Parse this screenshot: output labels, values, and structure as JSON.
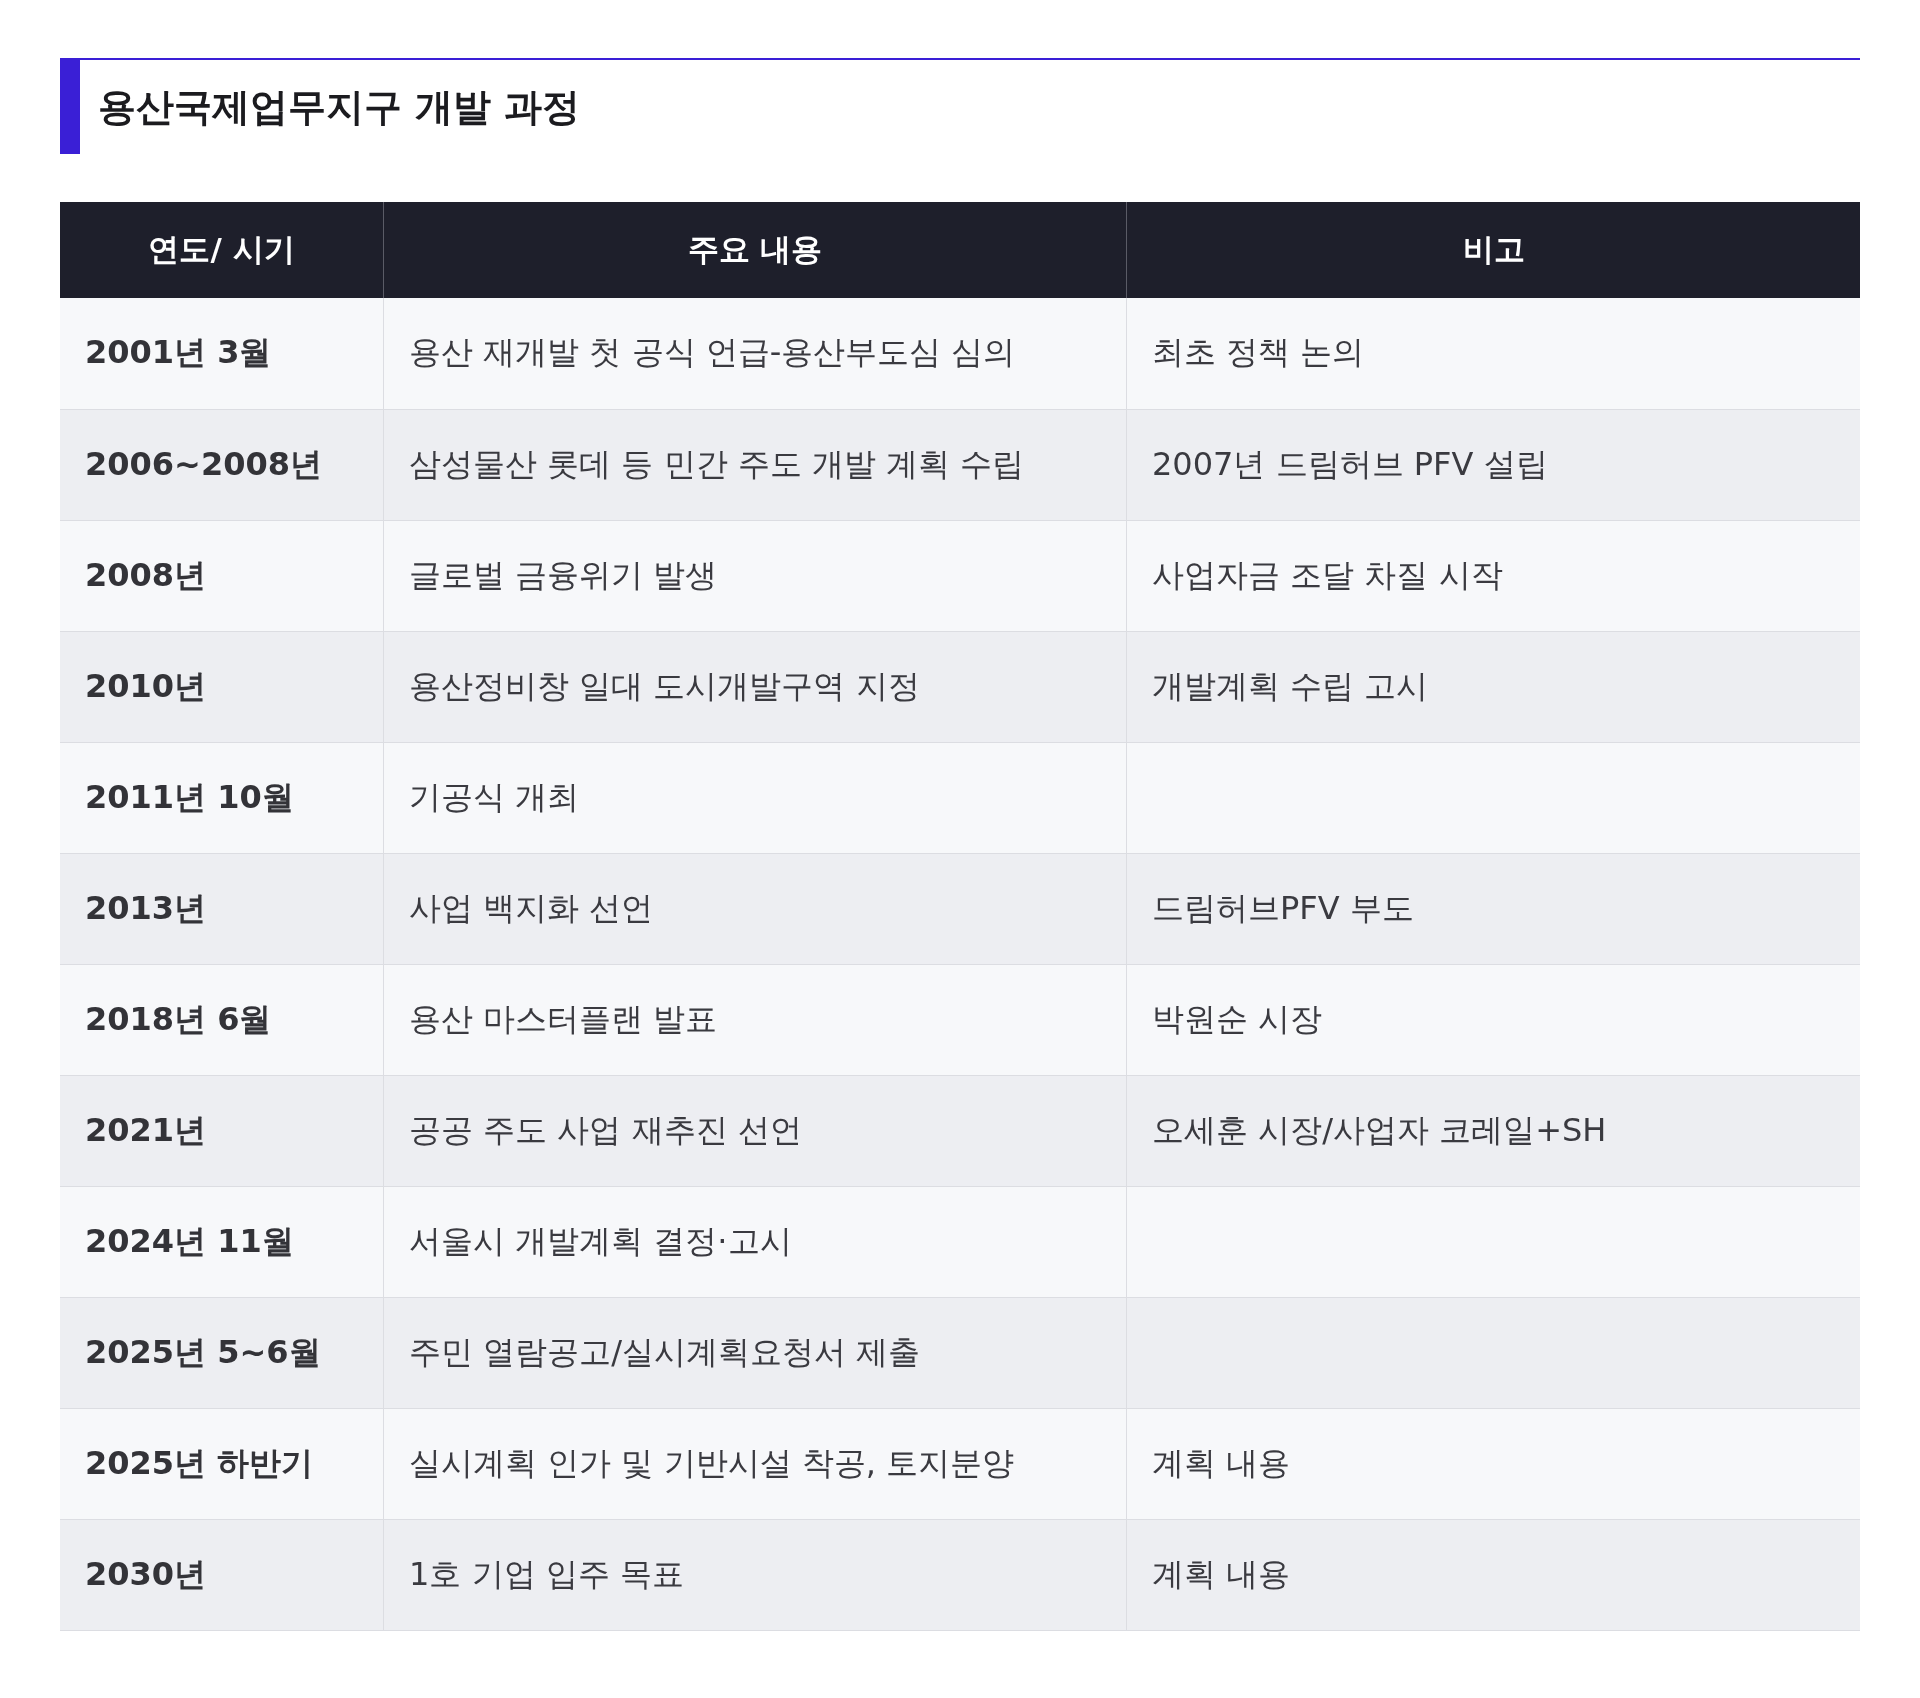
{
  "title": "용산국제업무지구 개발 과정",
  "table": {
    "columns": [
      "연도/ 시기",
      "주요 내용",
      "비고"
    ],
    "rows": [
      {
        "period": "2001년 3월",
        "content": "용산 재개발 첫 공식 언급-용산부도심 심의",
        "note": "최초 정책 논의"
      },
      {
        "period": "2006~2008년",
        "content": "삼성물산 롯데 등 민간 주도 개발 계획 수립",
        "note": "2007년 드림허브 PFV 설립"
      },
      {
        "period": "2008년",
        "content": "글로벌 금융위기 발생",
        "note": "사업자금 조달 차질 시작"
      },
      {
        "period": "2010년",
        "content": "용산정비창 일대 도시개발구역 지정",
        "note": "개발계획 수립 고시"
      },
      {
        "period": "2011년 10월",
        "content": "기공식 개최"
      },
      {
        "period": "2013년",
        "content": "사업 백지화 선언",
        "note": "드림허브PFV 부도"
      },
      {
        "period": "2018년 6월",
        "content": "용산 마스터플랜 발표",
        "note": "박원순 시장"
      },
      {
        "period": "2021년",
        "content": "공공 주도 사업 재추진 선언",
        "note": "오세훈 시장/사업자 코레일+SH"
      },
      {
        "period": "2024년 11월",
        "content": "서울시 개발계획 결정·고시"
      },
      {
        "period": "2025년 5~6월",
        "content": "주민 열람공고/실시계획요청서 제출"
      },
      {
        "period": "2025년 하반기",
        "content": "실시계획 인가 및 기반시설 착공, 토지분양",
        "note": "계획 내용"
      },
      {
        "period": "2030년",
        "content": "1호 기업 입주 목표",
        "note": "계획 내용"
      }
    ]
  }
}
